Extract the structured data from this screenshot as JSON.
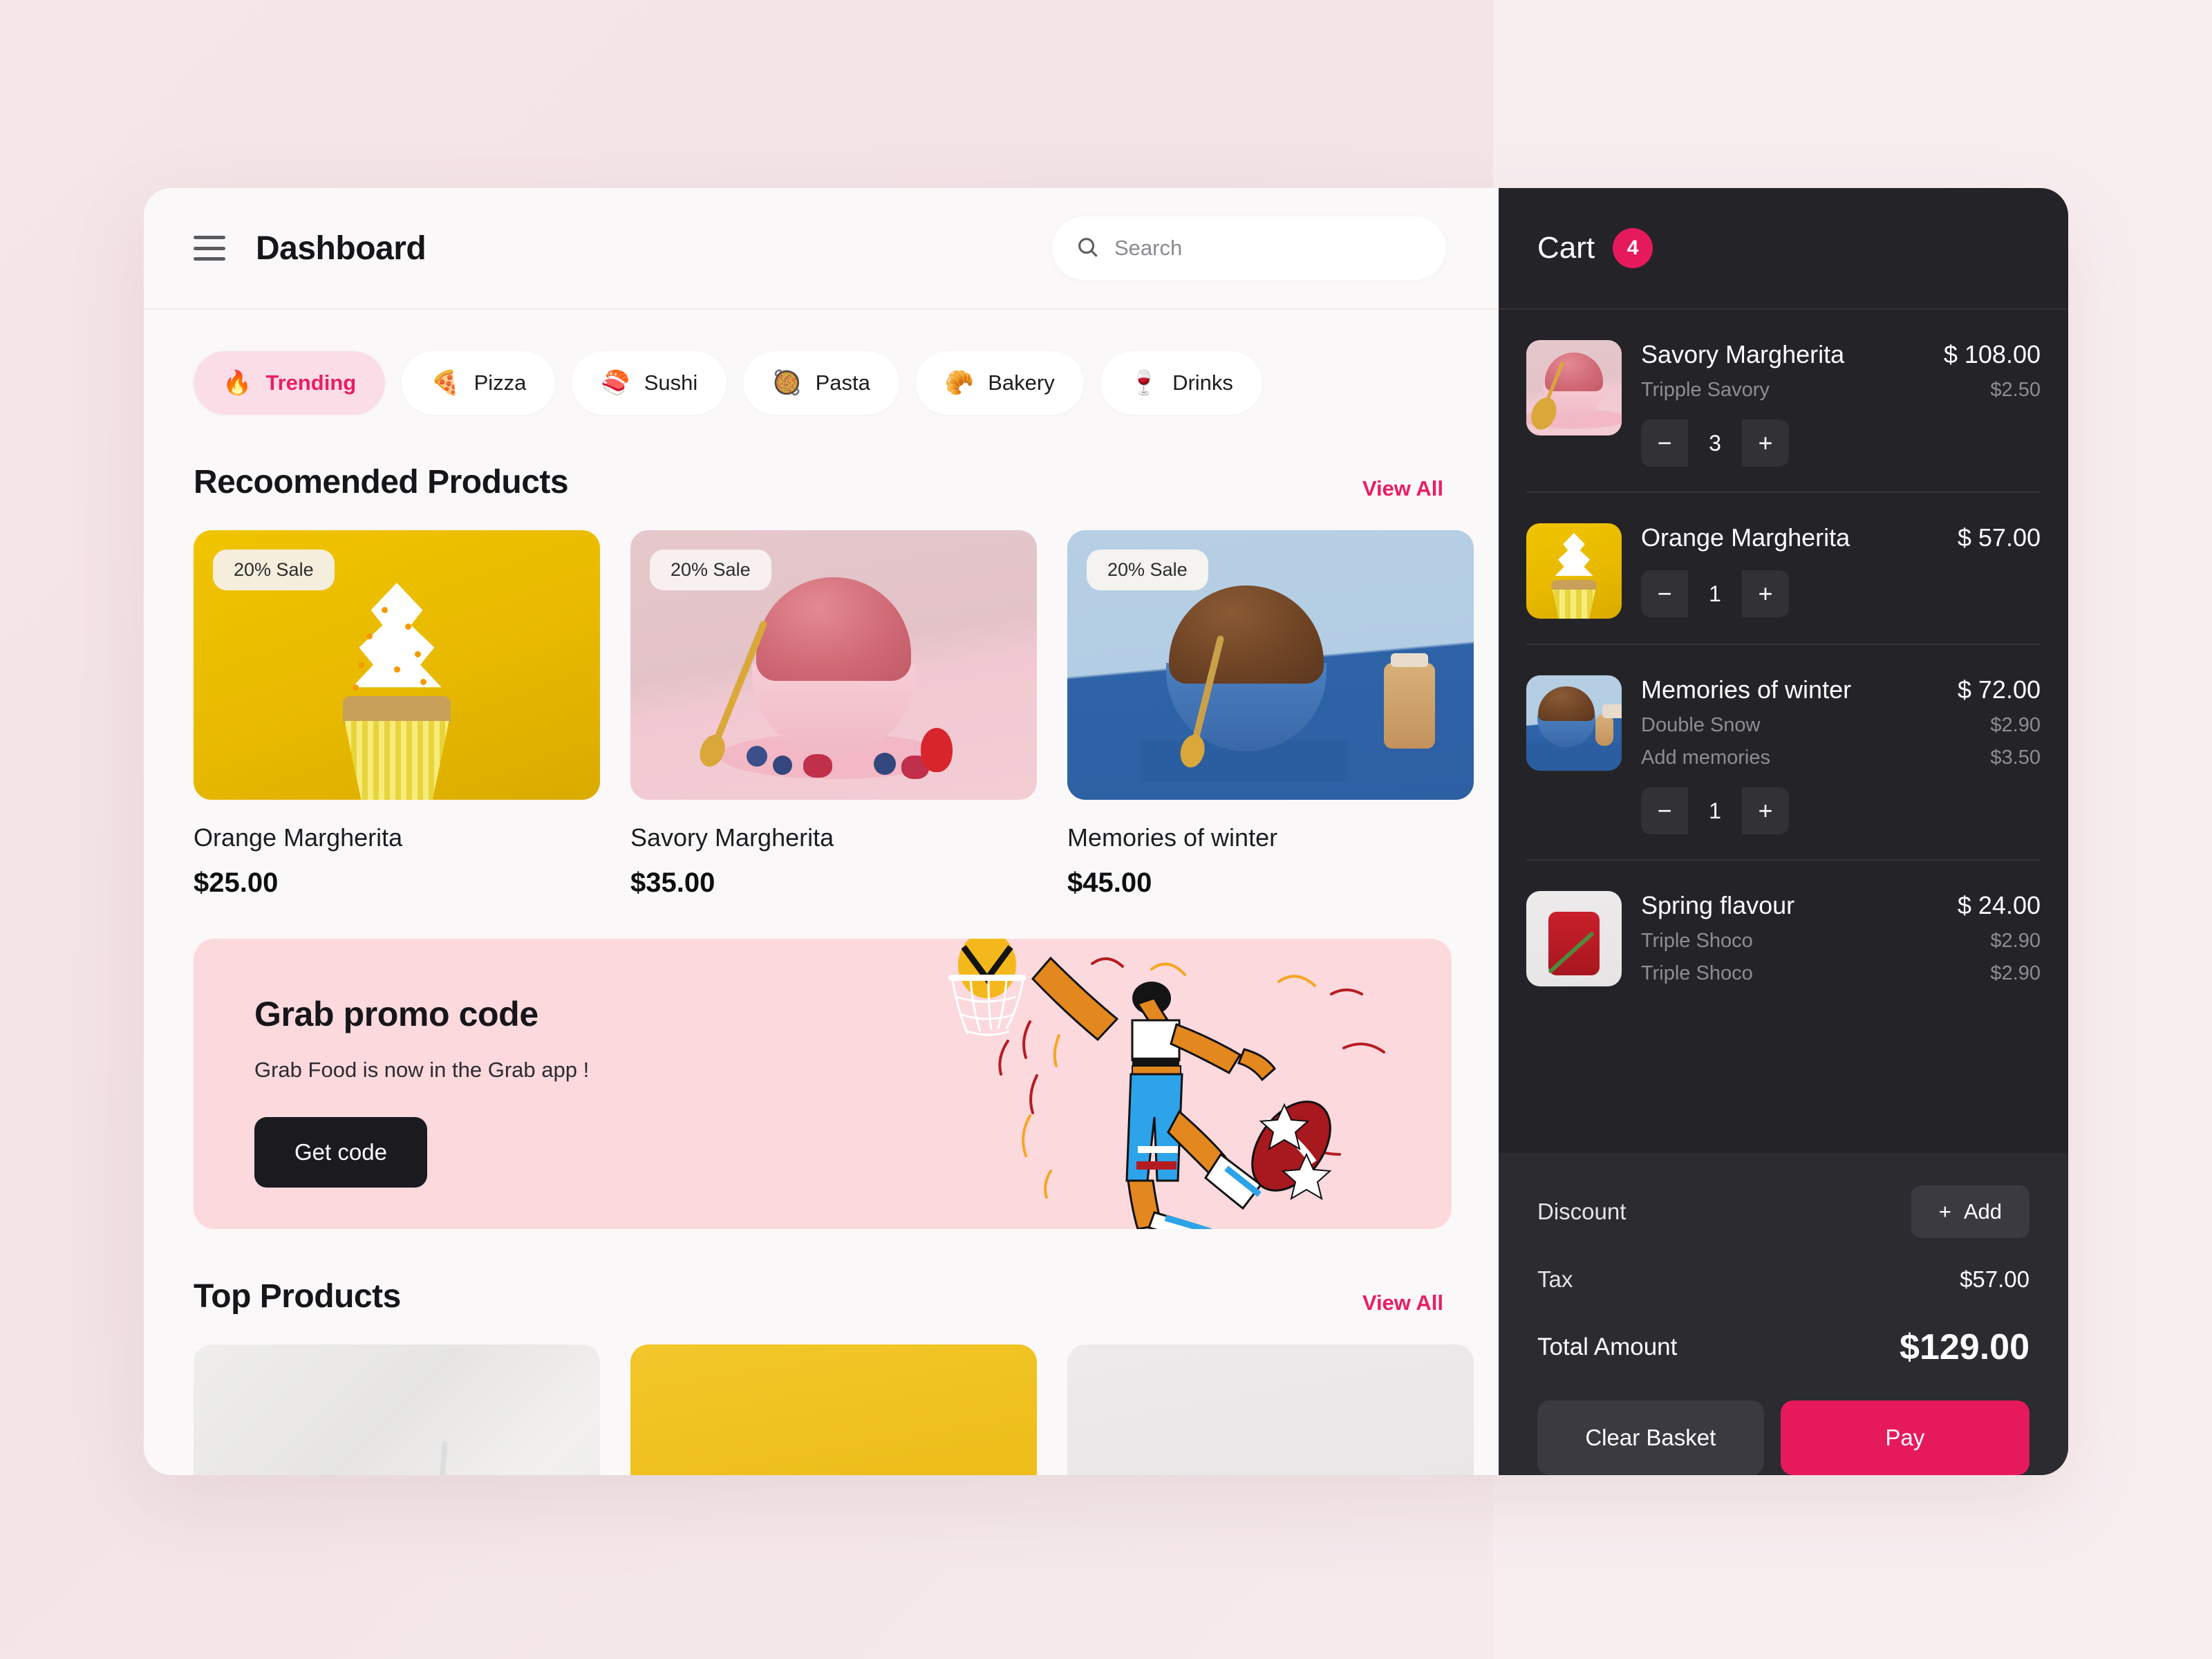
{
  "header": {
    "menu_icon": "hamburger-icon",
    "title": "Dashboard",
    "search": {
      "icon": "search-icon",
      "placeholder": "Search",
      "value": ""
    }
  },
  "categories": [
    {
      "label": "Trending",
      "emoji": "🔥",
      "active": true
    },
    {
      "label": "Pizza",
      "emoji": "🍕",
      "active": false
    },
    {
      "label": "Sushi",
      "emoji": "🍣",
      "active": false
    },
    {
      "label": "Pasta",
      "emoji": "🥘",
      "active": false
    },
    {
      "label": "Bakery",
      "emoji": "🥐",
      "active": false
    },
    {
      "label": "Drinks",
      "emoji": "🍷",
      "active": false
    }
  ],
  "recommended": {
    "title": "Recoomended Products",
    "view_all": "View All",
    "items": [
      {
        "badge": "20% Sale",
        "name": "Orange Margherita",
        "price": "$25.00"
      },
      {
        "badge": "20% Sale",
        "name": "Savory Margherita",
        "price": "$35.00"
      },
      {
        "badge": "20% Sale",
        "name": "Memories of winter",
        "price": "$45.00"
      }
    ]
  },
  "promo": {
    "title": "Grab promo code",
    "subtitle": "Grab Food is now in the Grab app !",
    "button": "Get code",
    "illustration": "basketball-dunk-illustration"
  },
  "top_products": {
    "title": "Top Products",
    "view_all": "View All"
  },
  "cart": {
    "title": "Cart",
    "count": "4",
    "items": [
      {
        "name": "Savory Margherita",
        "price": "$ 108.00",
        "qty": "3",
        "options": [
          {
            "name": "Tripple Savory",
            "price": "$2.50"
          }
        ]
      },
      {
        "name": "Orange Margherita",
        "price": "$ 57.00",
        "qty": "1",
        "options": []
      },
      {
        "name": "Memories of winter",
        "price": "$ 72.00",
        "qty": "1",
        "options": [
          {
            "name": "Double Snow",
            "price": "$2.90"
          },
          {
            "name": "Add memories",
            "price": "$3.50"
          }
        ]
      },
      {
        "name": "Spring flavour",
        "price": "$ 24.00",
        "qty": "",
        "options": [
          {
            "name": "Triple Shoco",
            "price": "$2.90"
          },
          {
            "name": "Triple Shoco",
            "price": "$2.90"
          }
        ]
      }
    ],
    "summary": {
      "discount_label": "Discount",
      "discount_add": "Add",
      "tax_label": "Tax",
      "tax_value": "$57.00",
      "total_label": "Total Amount",
      "total_value": "$129.00"
    },
    "actions": {
      "clear": "Clear Basket",
      "pay": "Pay"
    }
  },
  "stepper": {
    "minus": "−",
    "plus": "+"
  },
  "colors": {
    "accent_pink": "#e6195c",
    "cart_bg": "#242428",
    "promo_bg": "#fbd9dd",
    "page_bg": "#faf8f9"
  }
}
